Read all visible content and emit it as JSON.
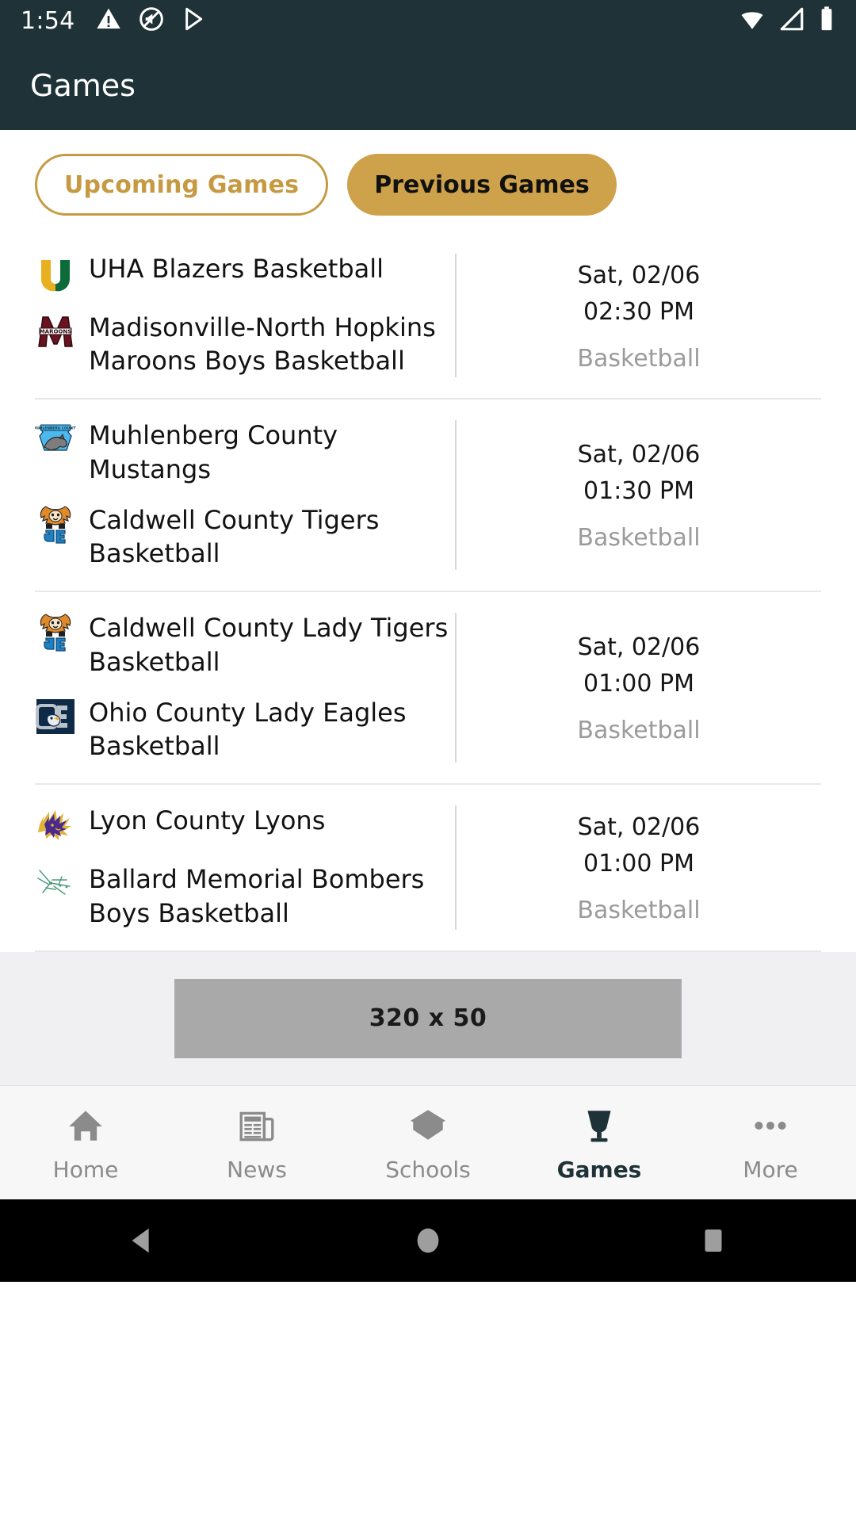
{
  "status_bar": {
    "time": "1:54",
    "left_icons": [
      "warning-triangle-icon",
      "no-sound-icon",
      "play-store-icon"
    ],
    "right_icons": [
      "wifi-icon",
      "cell-signal-icon",
      "battery-icon"
    ]
  },
  "header": {
    "title": "Games"
  },
  "tabs": {
    "upcoming_label": "Upcoming Games",
    "previous_label": "Previous Games",
    "selected": "Previous Games",
    "accent_color": "#c69a42",
    "active_fill_color": "#cea24a"
  },
  "games": [
    {
      "teams": [
        {
          "name": "UHA Blazers Basketball",
          "logo": "uha-blazers-logo"
        },
        {
          "name": "Madisonville-North Hopkins Maroons Boys Basketball",
          "logo": "maroons-logo"
        }
      ],
      "date": "Sat, 02/06",
      "time": "02:30 PM",
      "sport": "Basketball"
    },
    {
      "teams": [
        {
          "name": "Muhlenberg County Mustangs",
          "logo": "mustangs-logo"
        },
        {
          "name": "Caldwell County Tigers Basketball",
          "logo": "caldwell-tigers-logo"
        }
      ],
      "date": "Sat, 02/06",
      "time": "01:30 PM",
      "sport": "Basketball"
    },
    {
      "teams": [
        {
          "name": "Caldwell County Lady Tigers Basketball",
          "logo": "caldwell-tigers-logo"
        },
        {
          "name": "Ohio County Lady Eagles Basketball",
          "logo": "ohio-county-eagles-logo"
        }
      ],
      "date": "Sat, 02/06",
      "time": "01:00 PM",
      "sport": "Basketball"
    },
    {
      "teams": [
        {
          "name": "Lyon County Lyons",
          "logo": "lyon-county-lions-logo"
        },
        {
          "name": "Ballard Memorial Bombers Boys Basketball",
          "logo": "ballard-bombers-logo"
        }
      ],
      "date": "Sat, 02/06",
      "time": "01:00 PM",
      "sport": "Basketball"
    }
  ],
  "ad": {
    "label": "320 x 50"
  },
  "bottom_nav": {
    "items": [
      {
        "label": "Home",
        "icon": "home-icon",
        "active": false
      },
      {
        "label": "News",
        "icon": "newspaper-icon",
        "active": false
      },
      {
        "label": "Schools",
        "icon": "graduation-cap-icon",
        "active": false
      },
      {
        "label": "Games",
        "icon": "trophy-icon",
        "active": true
      },
      {
        "label": "More",
        "icon": "ellipsis-icon",
        "active": false
      }
    ]
  },
  "android_nav": {
    "buttons": [
      "back-icon",
      "home-circle-icon",
      "recents-square-icon"
    ]
  }
}
